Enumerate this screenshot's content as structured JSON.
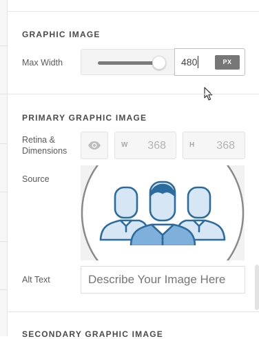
{
  "graphic_image": {
    "title": "GRAPHIC IMAGE",
    "max_width_label": "Max Width",
    "max_width_value": "480",
    "unit_label": "PX",
    "slider_level": 0.88
  },
  "primary": {
    "title": "PRIMARY GRAPHIC IMAGE",
    "retina_label": "Retina & Dimensions",
    "width_letter": "W",
    "width_value": "368",
    "height_letter": "H",
    "height_value": "368",
    "source_label": "Source",
    "alt_label": "Alt Text",
    "alt_placeholder": "Describe Your Image Here"
  },
  "secondary": {
    "title": "SECONDARY GRAPHIC IMAGE"
  },
  "icons": {
    "retina": "eye-icon",
    "cursor": "mouse-pointer-icon",
    "image": "team-people-icon"
  },
  "colors": {
    "icon_stroke": "#2c6b9e",
    "icon_light": "#d6e6f4",
    "icon_mid": "#7fb0dc",
    "unit_button": "#777777"
  }
}
